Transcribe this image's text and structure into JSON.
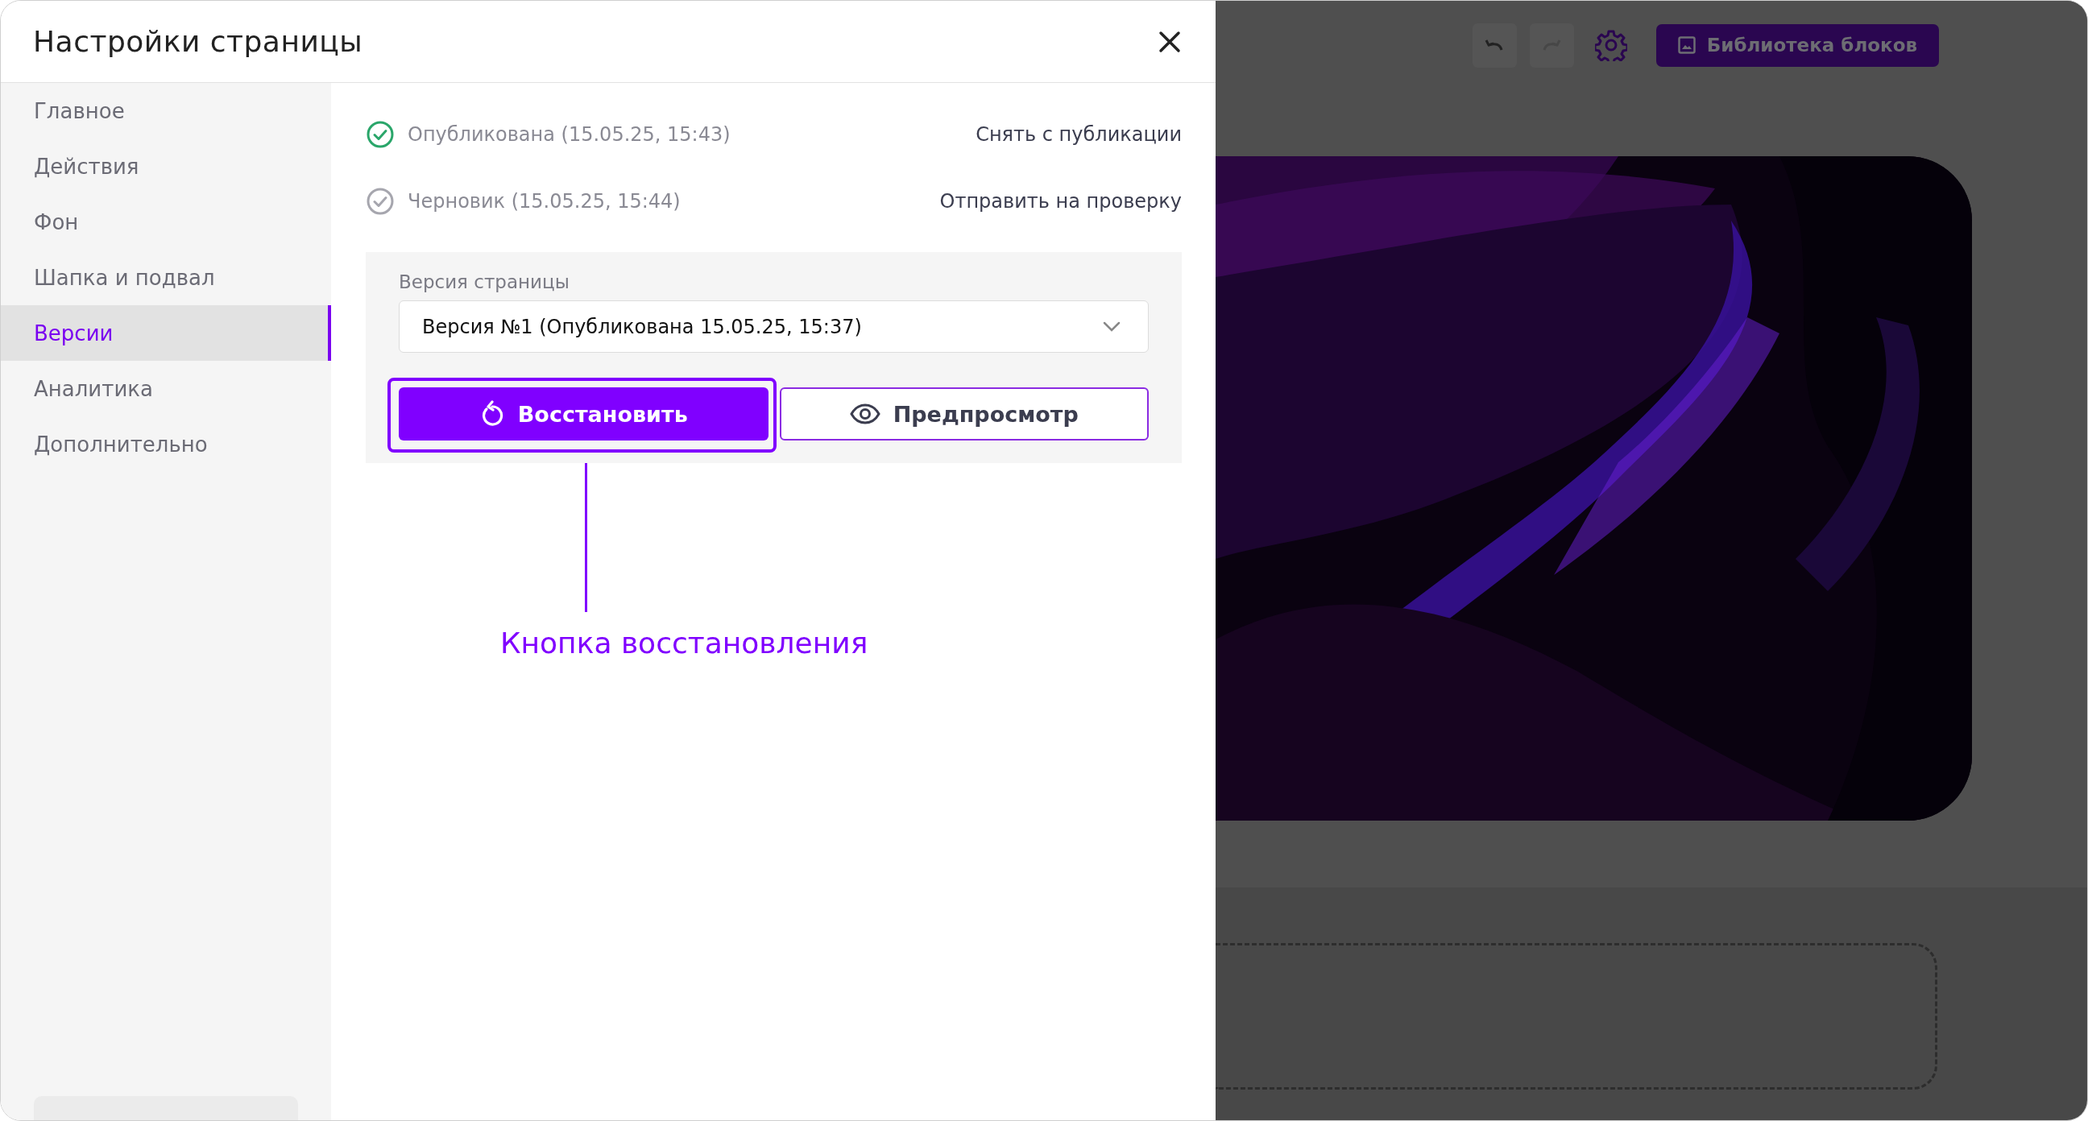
{
  "dialog": {
    "title": "Настройки страницы"
  },
  "sidebar": {
    "items": [
      {
        "label": "Главное",
        "selected": false
      },
      {
        "label": "Действия",
        "selected": false
      },
      {
        "label": "Фон",
        "selected": false
      },
      {
        "label": "Шапка и подвал",
        "selected": false
      },
      {
        "label": "Версии",
        "selected": true
      },
      {
        "label": "Аналитика",
        "selected": false
      },
      {
        "label": "Дополнительно",
        "selected": false
      }
    ]
  },
  "statuses": [
    {
      "label": "Опубликована (15.05.25, 15:43)",
      "done": true,
      "action": "Снять с публикации"
    },
    {
      "label": "Черновик (15.05.25, 15:44)",
      "done": false,
      "action": "Отправить на проверку"
    }
  ],
  "version": {
    "label": "Версия страницы",
    "value": "Версия №1 (Опубликована 15.05.25, 15:37)"
  },
  "buttons": [
    {
      "kind": "primary",
      "label": "Восстановить",
      "highlighted": true
    },
    {
      "kind": "secondary",
      "label": "Предпросмотр",
      "highlighted": false
    }
  ],
  "annotation": {
    "text": "Кнопка восстановления"
  },
  "toolbar": {
    "library_button": "Библиотека блоков"
  }
}
